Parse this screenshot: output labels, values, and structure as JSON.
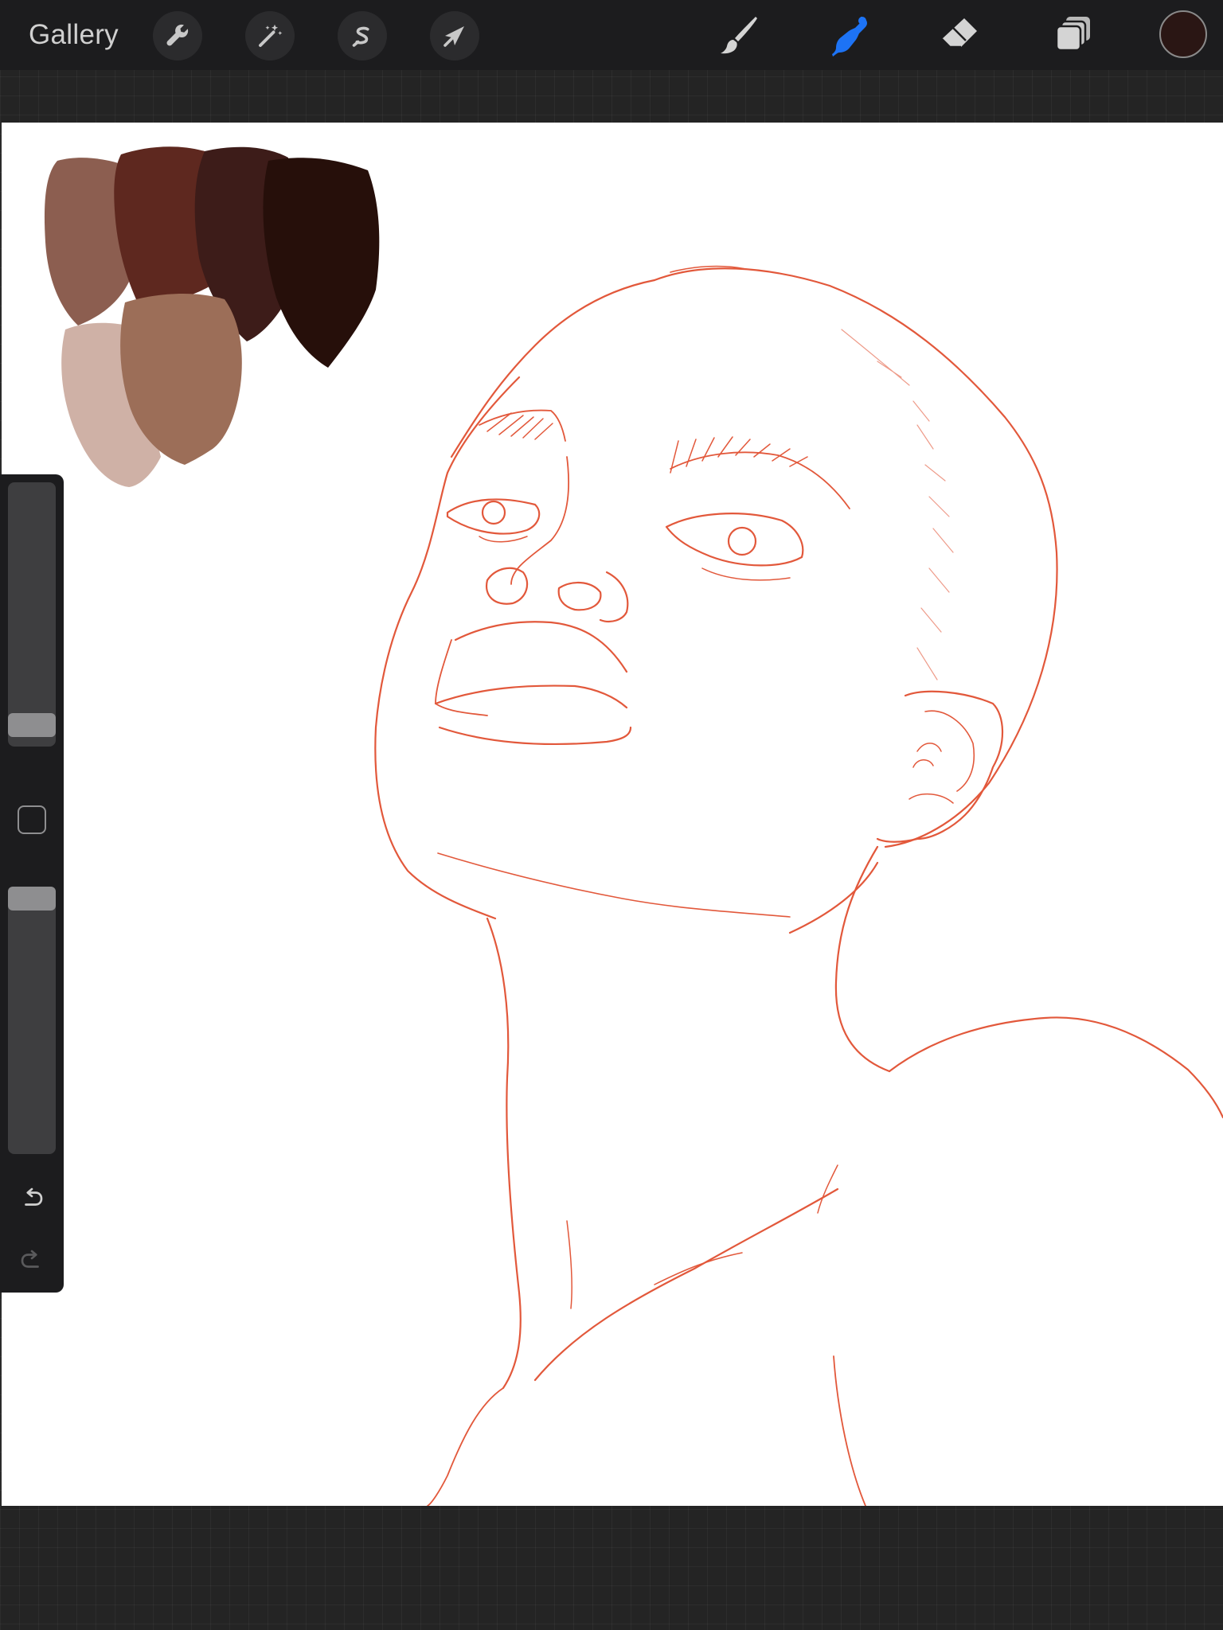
{
  "topbar": {
    "gallery_label": "Gallery",
    "left_tools": [
      {
        "name": "actions",
        "icon": "wrench-icon"
      },
      {
        "name": "adjustments",
        "icon": "magic-wand-icon"
      },
      {
        "name": "selection",
        "icon": "selection-s-icon"
      },
      {
        "name": "transform",
        "icon": "arrow-cursor-icon"
      }
    ],
    "right_tools": [
      {
        "name": "brush",
        "icon": "paintbrush-icon",
        "active": false
      },
      {
        "name": "smudge",
        "icon": "smudge-finger-icon",
        "active": true
      },
      {
        "name": "eraser",
        "icon": "eraser-icon",
        "active": false
      },
      {
        "name": "layers",
        "icon": "layers-icon",
        "active": false
      }
    ],
    "current_color": "#2a1614"
  },
  "sidebar": {
    "brush_size_icon": "size-slider",
    "modify_icon": "square-modify-icon",
    "opacity_icon": "opacity-slider",
    "undo_icon": "undo-icon",
    "redo_icon": "redo-icon"
  },
  "palette": {
    "swatches": [
      "#8c5e50",
      "#5e281f",
      "#3d1c19",
      "#260f0a",
      "#cfb1a6",
      "#9c6e58"
    ]
  },
  "colors": {
    "accent_active": "#1d73f5",
    "sketch_line": "#e04a2a",
    "toolbar_bg": "#1c1c1e"
  }
}
